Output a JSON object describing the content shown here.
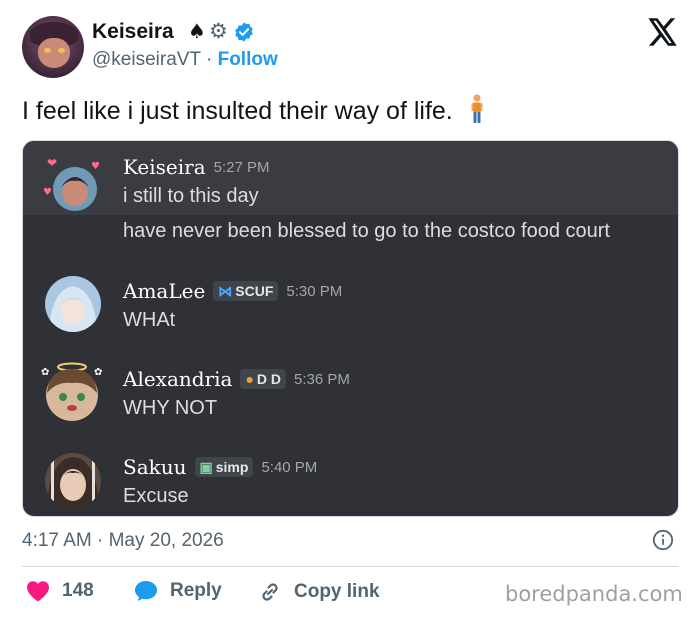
{
  "author": {
    "display_name": "Keiseira",
    "handle": "@keiseiraVT",
    "separator": "·",
    "follow_label": "Follow",
    "badges": [
      "spade-icon",
      "gear-icon",
      "verified-badge-icon"
    ]
  },
  "tweet": {
    "text": "I feel like i just insulted their way of life.",
    "emoji": "person-standing-emoji"
  },
  "discord": {
    "background": "#2f3136",
    "messages": [
      {
        "name": "Keiseira",
        "time": "5:27 PM",
        "tag": "",
        "lines": [
          "i still to this day",
          "have never been blessed to go to the costco food court"
        ]
      },
      {
        "name": "AmaLee",
        "time": "5:30 PM",
        "tag": "SCUF",
        "lines": [
          "WHAt"
        ]
      },
      {
        "name": "Alexandria",
        "time": "5:36 PM",
        "tag": "D D",
        "lines": [
          "WHY NOT"
        ]
      },
      {
        "name": "Sakuu",
        "time": "5:40 PM",
        "tag": "simp",
        "lines": [
          "Excuse"
        ]
      }
    ]
  },
  "meta": {
    "timestamp": "4:17 AM · May 20, 2026"
  },
  "actions": {
    "likes_count": "148",
    "reply_label": "Reply",
    "copy_link_label": "Copy link"
  },
  "watermark": "boredpanda.com",
  "colors": {
    "accent": "#1d9bf0",
    "heart": "#f91880",
    "text_secondary": "#536471"
  }
}
